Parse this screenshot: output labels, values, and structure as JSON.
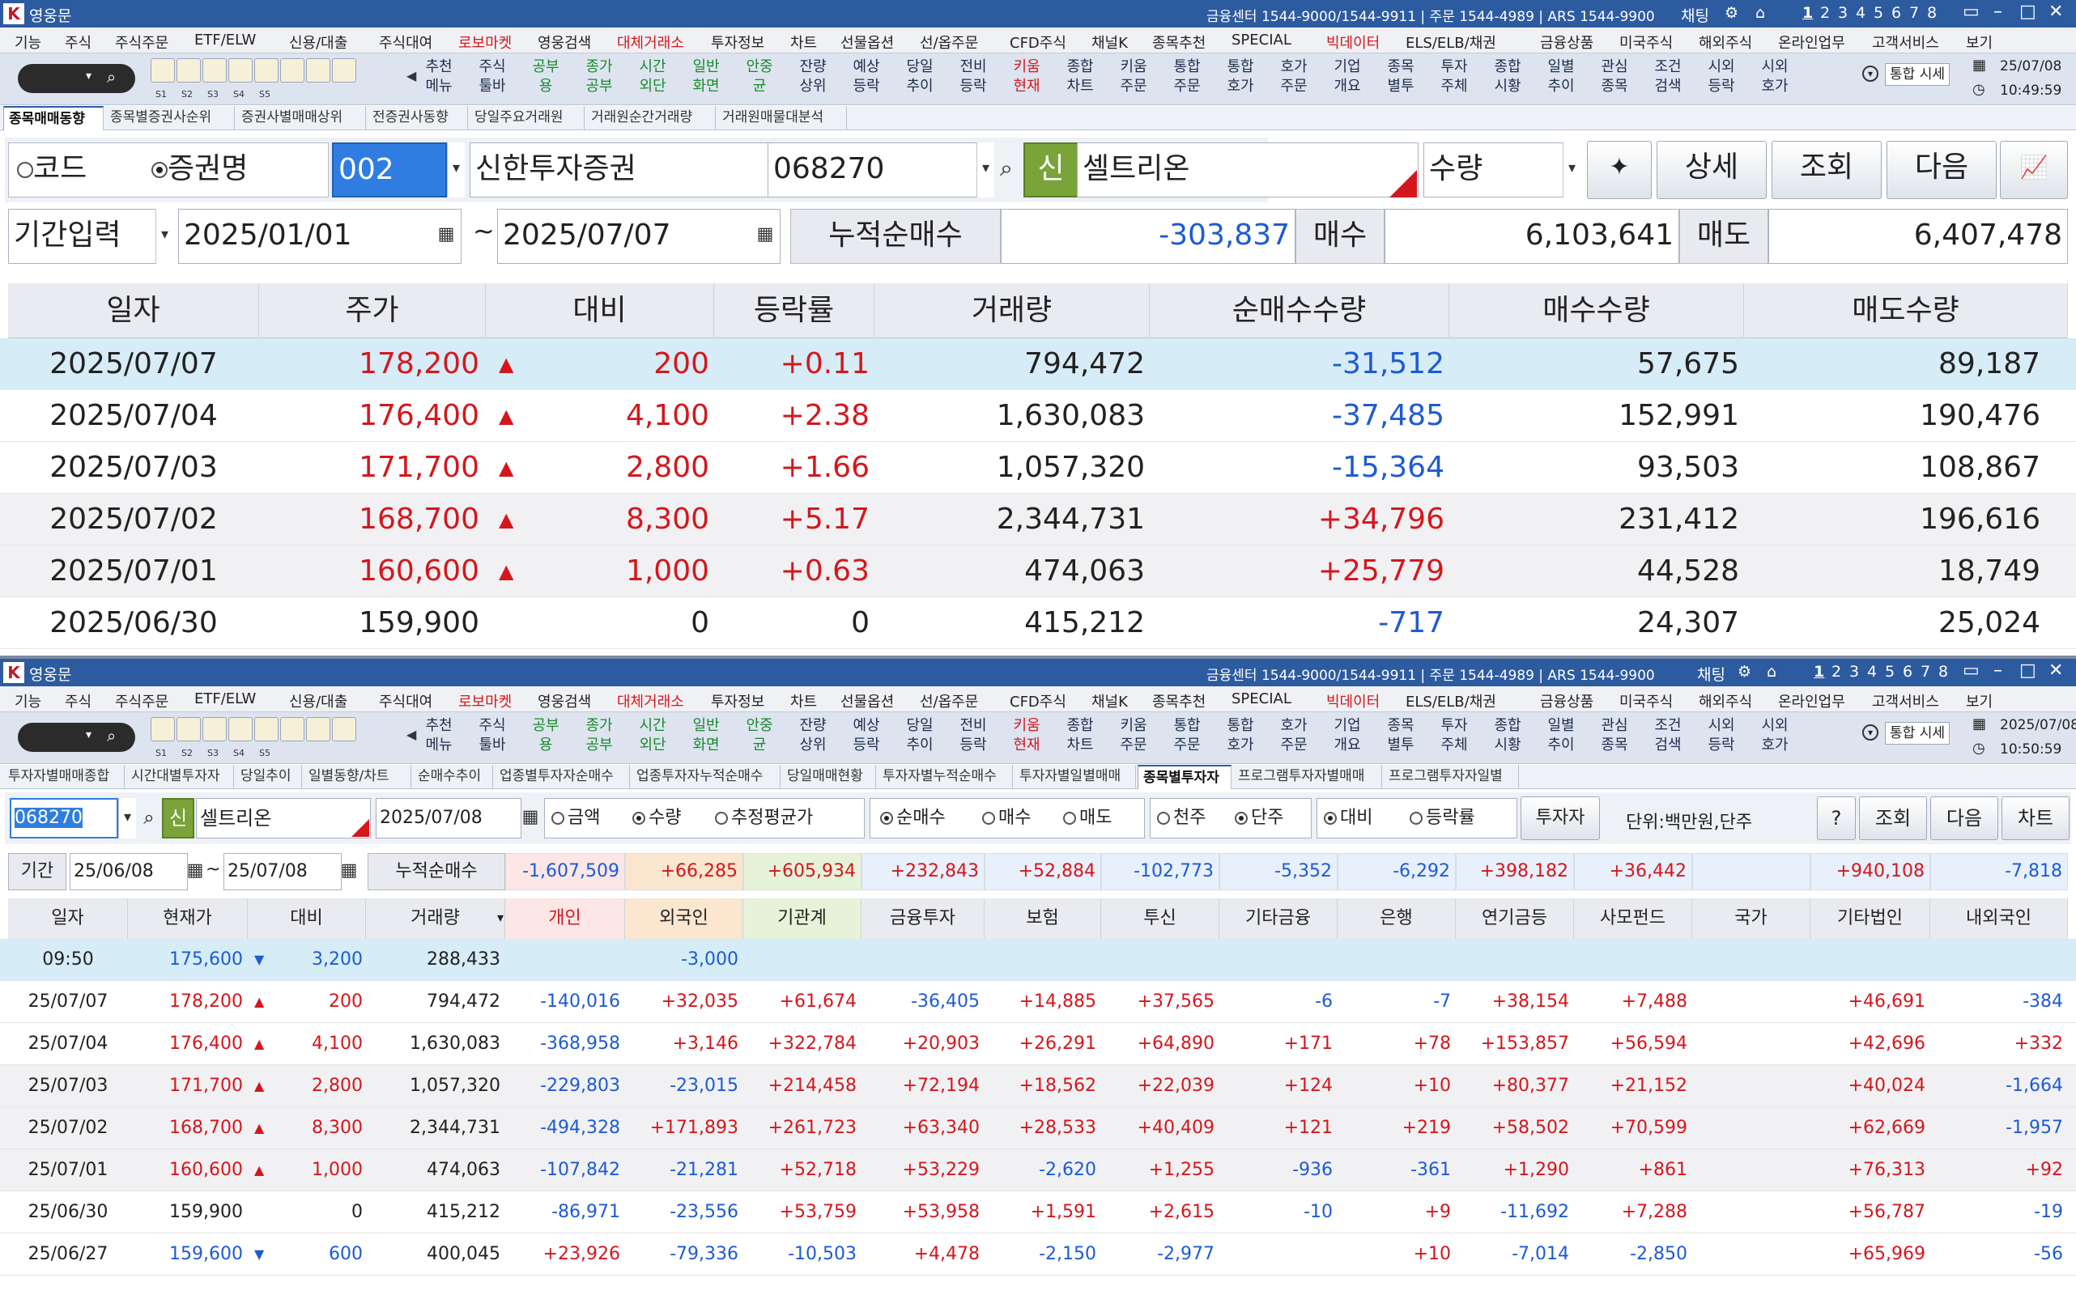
{
  "window1": {
    "title": "영웅문",
    "phones": "금융센터 1544-9000/1544-9911 | 주문 1544-4989 | ARS 1544-9900",
    "chat": "채팅",
    "screen_nums": [
      "1",
      "2",
      "3",
      "4",
      "5",
      "6",
      "7",
      "8"
    ],
    "menu": [
      "기능",
      "주식",
      "주식주문",
      "ETF/ELW",
      "신용/대출",
      "주식대여",
      "로보마켓",
      "영웅검색",
      "대체거래소",
      "투자정보",
      "차트",
      "선물옵션",
      "선/옵주문",
      "CFD주식",
      "채널K",
      "종목추천",
      "SPECIAL",
      "빅데이터",
      "ELS/ELB/채권",
      "금융상품",
      "미국주식",
      "해외주식",
      "온라인업무",
      "고객서비스",
      "보기"
    ],
    "toolbar_slots": [
      "S1",
      "S2",
      "S3",
      "S4",
      "S5"
    ],
    "toolbar": [
      {
        "l1": "추천",
        "l2": "메뉴",
        "c": ""
      },
      {
        "l1": "주식",
        "l2": "툴바",
        "c": ""
      },
      {
        "l1": "공부",
        "l2": "용",
        "c": "green"
      },
      {
        "l1": "종가",
        "l2": "공부",
        "c": "green"
      },
      {
        "l1": "시간",
        "l2": "외단",
        "c": "green"
      },
      {
        "l1": "일반",
        "l2": "화면",
        "c": "green"
      },
      {
        "l1": "안중",
        "l2": "균",
        "c": "green"
      },
      {
        "l1": "잔량",
        "l2": "상위",
        "c": ""
      },
      {
        "l1": "예상",
        "l2": "등락",
        "c": ""
      },
      {
        "l1": "당일",
        "l2": "추이",
        "c": ""
      },
      {
        "l1": "전비",
        "l2": "등락",
        "c": ""
      },
      {
        "l1": "키움",
        "l2": "현재",
        "c": "red"
      },
      {
        "l1": "종합",
        "l2": "차트",
        "c": ""
      },
      {
        "l1": "키움",
        "l2": "주문",
        "c": ""
      },
      {
        "l1": "통합",
        "l2": "주문",
        "c": ""
      },
      {
        "l1": "통합",
        "l2": "호가",
        "c": ""
      },
      {
        "l1": "호가",
        "l2": "주문",
        "c": ""
      },
      {
        "l1": "기업",
        "l2": "개요",
        "c": ""
      },
      {
        "l1": "종목",
        "l2": "별투",
        "c": ""
      },
      {
        "l1": "투자",
        "l2": "주체",
        "c": ""
      },
      {
        "l1": "종합",
        "l2": "시황",
        "c": ""
      },
      {
        "l1": "일별",
        "l2": "추이",
        "c": ""
      },
      {
        "l1": "관심",
        "l2": "종목",
        "c": ""
      },
      {
        "l1": "조건",
        "l2": "검색",
        "c": ""
      },
      {
        "l1": "시외",
        "l2": "등락",
        "c": ""
      },
      {
        "l1": "시외",
        "l2": "호가",
        "c": ""
      }
    ],
    "integrated_quote": "통합 시세",
    "date": "25/07/08",
    "time": "10:49:59",
    "tabs": [
      "종목매매동향",
      "종목별증권사순위",
      "증권사별매매상위",
      "전증권사동향",
      "당일주요거래원",
      "거래원순간거래량",
      "거래원매물대분석"
    ],
    "radio_code": "코드",
    "radio_name": "증권명",
    "broker_code": "002",
    "broker_name": "신한투자증권",
    "stock_code": "068270",
    "shin": "신",
    "stock_name": "셀트리온",
    "qty_select": "수량",
    "btn_detail": "상세",
    "btn_query": "조회",
    "btn_next": "다음",
    "period_select": "기간입력",
    "date_from": "2025/01/01",
    "tilde": "~",
    "date_to": "2025/07/07",
    "cum_label": "누적순매수",
    "cum_value": "-303,837",
    "buy_label": "매수",
    "buy_value": "6,103,641",
    "sell_label": "매도",
    "sell_value": "6,407,478",
    "columns": [
      "일자",
      "주가",
      "대비",
      "등락률",
      "거래량",
      "순매수수량",
      "매수수량",
      "매도수량"
    ],
    "rows": [
      {
        "date": "2025/07/07",
        "price": "178,200",
        "tri": "up",
        "diff": "200",
        "rate": "+0.11",
        "vol": "794,472",
        "net": "-31,512",
        "buy": "57,675",
        "sell": "89,187"
      },
      {
        "date": "2025/07/04",
        "price": "176,400",
        "tri": "up",
        "diff": "4,100",
        "rate": "+2.38",
        "vol": "1,630,083",
        "net": "-37,485",
        "buy": "152,991",
        "sell": "190,476"
      },
      {
        "date": "2025/07/03",
        "price": "171,700",
        "tri": "up",
        "diff": "2,800",
        "rate": "+1.66",
        "vol": "1,057,320",
        "net": "-15,364",
        "buy": "93,503",
        "sell": "108,867"
      },
      {
        "date": "2025/07/02",
        "price": "168,700",
        "tri": "up",
        "diff": "8,300",
        "rate": "+5.17",
        "vol": "2,344,731",
        "net": "+34,796",
        "buy": "231,412",
        "sell": "196,616"
      },
      {
        "date": "2025/07/01",
        "price": "160,600",
        "tri": "up",
        "diff": "1,000",
        "rate": "+0.63",
        "vol": "474,063",
        "net": "+25,779",
        "buy": "44,528",
        "sell": "18,749"
      },
      {
        "date": "2025/06/30",
        "price": "159,900",
        "tri": "",
        "diff": "0",
        "rate": "0",
        "vol": "415,212",
        "net": "-717",
        "buy": "24,307",
        "sell": "25,024"
      }
    ]
  },
  "window2": {
    "title": "영웅문",
    "phones": "금융센터 1544-9000/1544-9911 | 주문 1544-4989 | ARS 1544-9900",
    "chat": "채팅",
    "integrated_quote": "통합 시세",
    "date": "2025/07/08",
    "time": "10:50:59",
    "tabs": [
      "투자자별매매종합",
      "시간대별투자자",
      "당일추이",
      "일별동향/차트",
      "순매수추이",
      "업종별투자자순매수",
      "업종투자자누적순매수",
      "당일매매현황",
      "투자자별누적순매수",
      "투자자별일별매매",
      "종목별투자자",
      "프로그램투자자별매매",
      "프로그램투자자일별"
    ],
    "active_tab": 10,
    "stock_code": "068270",
    "shin": "신",
    "stock_name": "셀트리온",
    "radio_amount": "금액",
    "radio_qty": "수량",
    "radio_avg": "추정평균가",
    "radio_net": "순매수",
    "radio_buy": "매수",
    "radio_sell": "매도",
    "radio_thousand": "천주",
    "radio_unit": "단주",
    "radio_diff": "대비",
    "radio_rate": "등락률",
    "btn_investor": "투자자",
    "unit_text": "단위:백만원,단주",
    "btn_help": "?",
    "btn_query": "조회",
    "btn_next": "다음",
    "btn_chart": "차트",
    "period_label": "기간",
    "period_from": "25/06/08",
    "period_to": "25/07/08",
    "cum_label": "누적순매수",
    "cum_values": [
      "-1,607,509",
      "+66,285",
      "+605,934",
      "+232,843",
      "+52,884",
      "-102,773",
      "-5,352",
      "-6,292",
      "+398,182",
      "+36,442",
      "",
      "+940,108",
      "-7,818"
    ],
    "columns": [
      "일자",
      "현재가",
      "대비",
      "거래량",
      "개인",
      "외국인",
      "기관계",
      "금융투자",
      "보험",
      "투신",
      "기타금융",
      "은행",
      "연기금등",
      "사모펀드",
      "국가",
      "기타법인",
      "내외국인"
    ],
    "rows": [
      {
        "date": "09:50",
        "price": "175,600",
        "tri": "dn",
        "diff": "3,200",
        "vol": "288,433",
        "v": [
          "",
          "-3,000",
          "",
          "",
          "",
          "",
          "",
          "",
          "",
          "",
          "",
          "",
          ""
        ]
      },
      {
        "date": "25/07/07",
        "price": "178,200",
        "tri": "up",
        "diff": "200",
        "vol": "794,472",
        "v": [
          "-140,016",
          "+32,035",
          "+61,674",
          "-36,405",
          "+14,885",
          "+37,565",
          "-6",
          "-7",
          "+38,154",
          "+7,488",
          "",
          "+46,691",
          "-384"
        ]
      },
      {
        "date": "25/07/04",
        "price": "176,400",
        "tri": "up",
        "diff": "4,100",
        "vol": "1,630,083",
        "v": [
          "-368,958",
          "+3,146",
          "+322,784",
          "+20,903",
          "+26,291",
          "+64,890",
          "+171",
          "+78",
          "+153,857",
          "+56,594",
          "",
          "+42,696",
          "+332"
        ]
      },
      {
        "date": "25/07/03",
        "price": "171,700",
        "tri": "up",
        "diff": "2,800",
        "vol": "1,057,320",
        "v": [
          "-229,803",
          "-23,015",
          "+214,458",
          "+72,194",
          "+18,562",
          "+22,039",
          "+124",
          "+10",
          "+80,377",
          "+21,152",
          "",
          "+40,024",
          "-1,664"
        ]
      },
      {
        "date": "25/07/02",
        "price": "168,700",
        "tri": "up",
        "diff": "8,300",
        "vol": "2,344,731",
        "v": [
          "-494,328",
          "+171,893",
          "+261,723",
          "+63,340",
          "+28,533",
          "+40,409",
          "+121",
          "+219",
          "+58,502",
          "+70,599",
          "",
          "+62,669",
          "-1,957"
        ]
      },
      {
        "date": "25/07/01",
        "price": "160,600",
        "tri": "up",
        "diff": "1,000",
        "vol": "474,063",
        "v": [
          "-107,842",
          "-21,281",
          "+52,718",
          "+53,229",
          "-2,620",
          "+1,255",
          "-936",
          "-361",
          "+1,290",
          "+861",
          "",
          "+76,313",
          "+92"
        ]
      },
      {
        "date": "25/06/30",
        "price": "159,900",
        "tri": "",
        "diff": "0",
        "vol": "415,212",
        "v": [
          "-86,971",
          "-23,556",
          "+53,759",
          "+53,958",
          "+1,591",
          "+2,615",
          "-10",
          "+9",
          "-11,692",
          "+7,288",
          "",
          "+56,787",
          "-19"
        ]
      },
      {
        "date": "25/06/27",
        "price": "159,600",
        "tri": "dn",
        "diff": "600",
        "vol": "400,045",
        "v": [
          "+23,926",
          "-79,336",
          "-10,503",
          "+4,478",
          "-2,150",
          "-2,977",
          "",
          "+10",
          "-7,014",
          "-2,850",
          "",
          "+65,969",
          "-56"
        ]
      }
    ]
  },
  "colors": {
    "up": "#d4171d",
    "down": "#1d5bd3",
    "title": "#2d5ba0",
    "row_highlight": "#d6ecf6",
    "row_gray": "#f1f1f3"
  }
}
